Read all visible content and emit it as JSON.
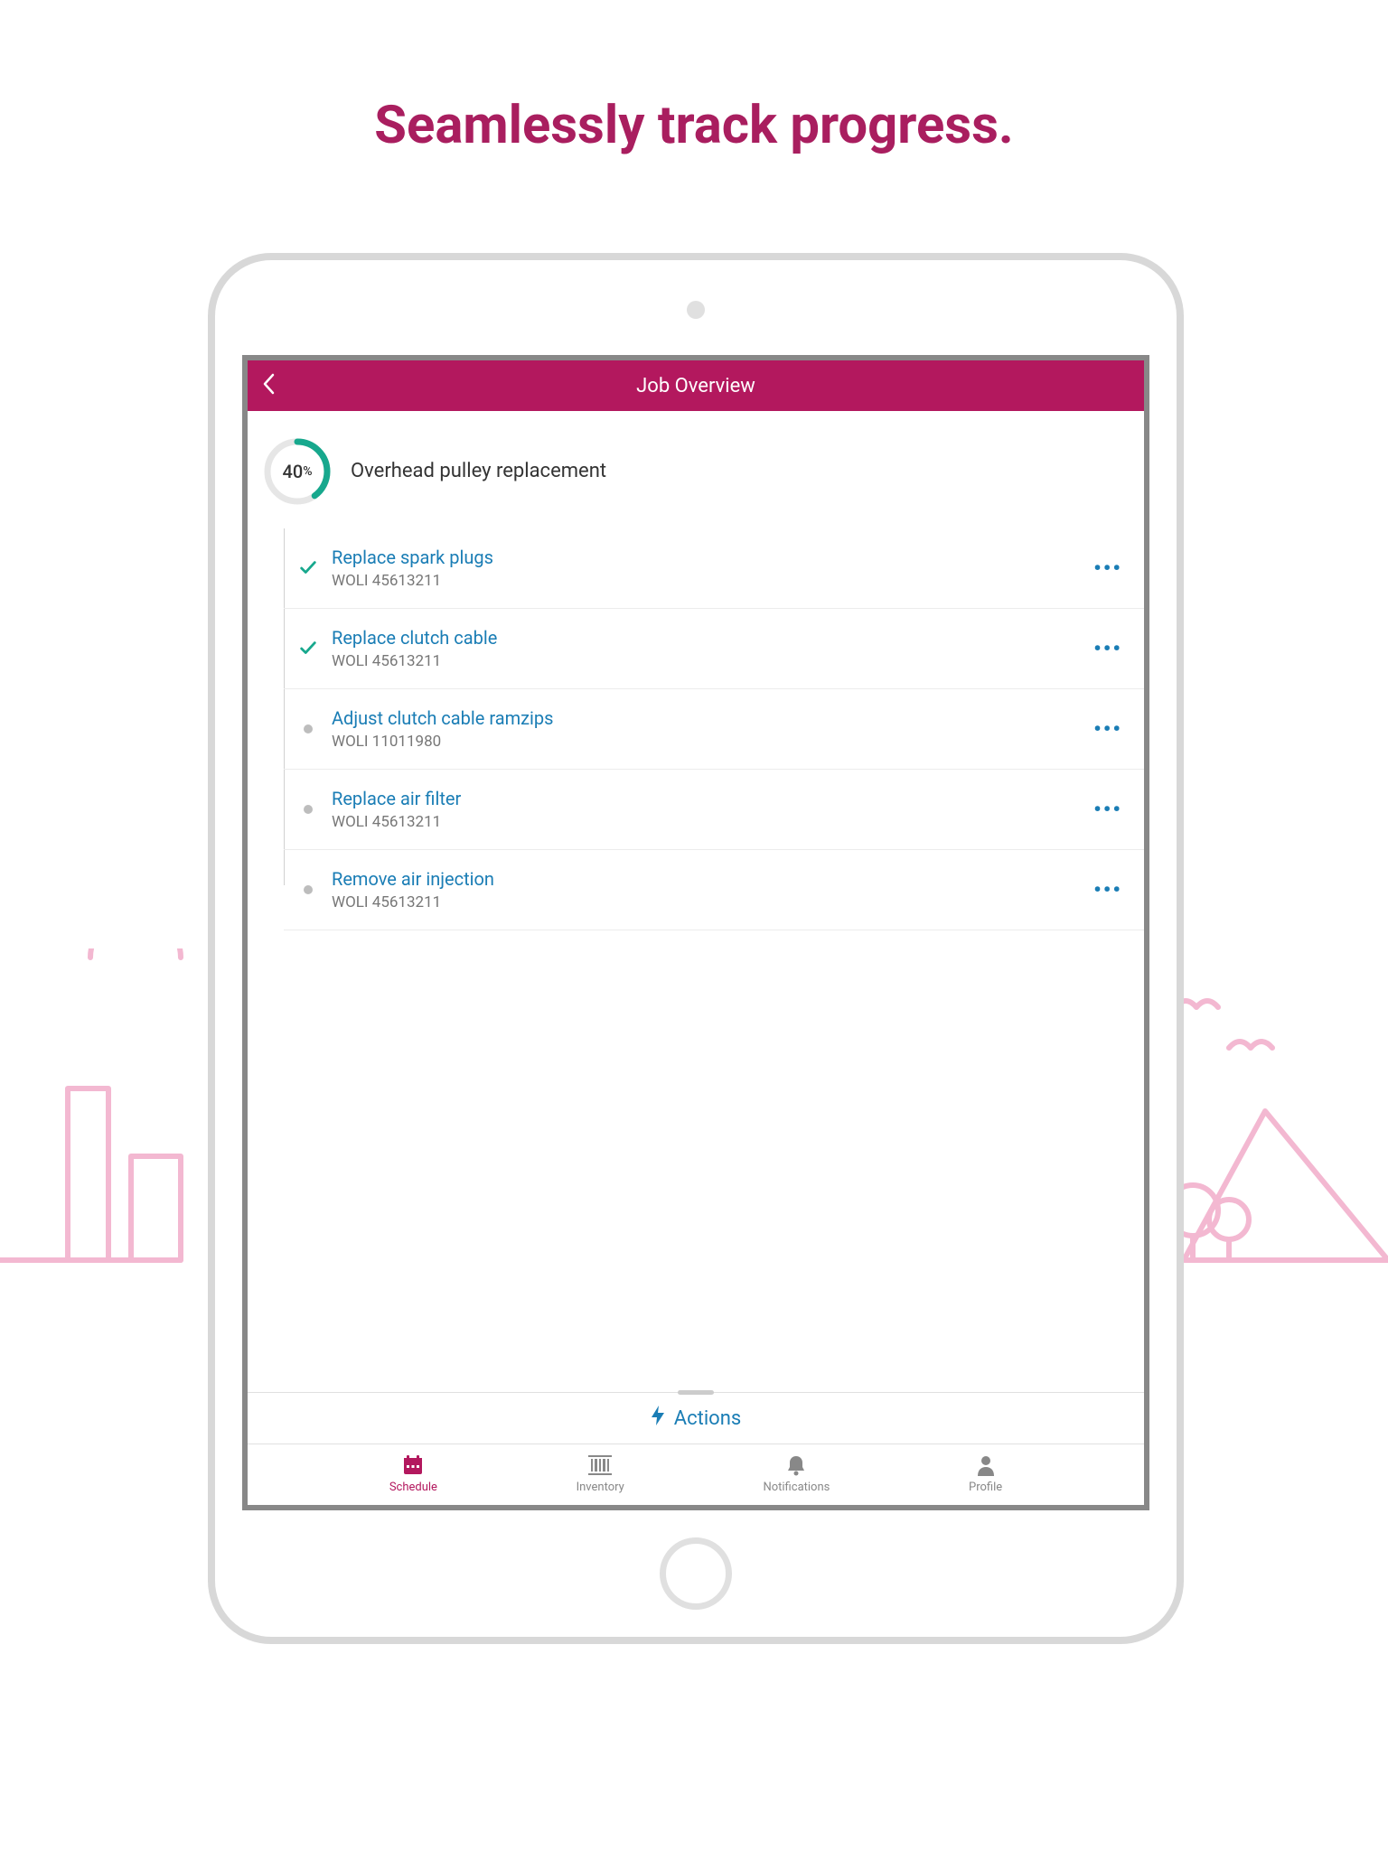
{
  "marketing": {
    "headline": "Seamlessly track progress."
  },
  "header": {
    "title": "Job Overview"
  },
  "progress": {
    "percent_text": "40",
    "percent_symbol": "%",
    "percent_value": 40,
    "title": "Overhead pulley replacement"
  },
  "tasks": [
    {
      "title": "Replace spark plugs",
      "sub": "WOLI 45613211",
      "status": "done"
    },
    {
      "title": "Replace clutch cable",
      "sub": "WOLI 45613211",
      "status": "done"
    },
    {
      "title": "Adjust clutch cable ramzips",
      "sub": "WOLI 11011980",
      "status": "pending"
    },
    {
      "title": "Replace air filter",
      "sub": "WOLI 45613211",
      "status": "pending"
    },
    {
      "title": "Remove air injection",
      "sub": "WOLI 45613211",
      "status": "pending"
    }
  ],
  "actions": {
    "label": "Actions"
  },
  "nav": {
    "items": [
      {
        "label": "Schedule",
        "icon": "calendar-icon",
        "active": true
      },
      {
        "label": "Inventory",
        "icon": "barcode-icon",
        "active": false
      },
      {
        "label": "Notifications",
        "icon": "bell-icon",
        "active": false
      },
      {
        "label": "Profile",
        "icon": "person-icon",
        "active": false
      }
    ]
  },
  "colors": {
    "brand": "#b3185e",
    "accent": "#1a7db5",
    "progress": "#17a88d"
  }
}
